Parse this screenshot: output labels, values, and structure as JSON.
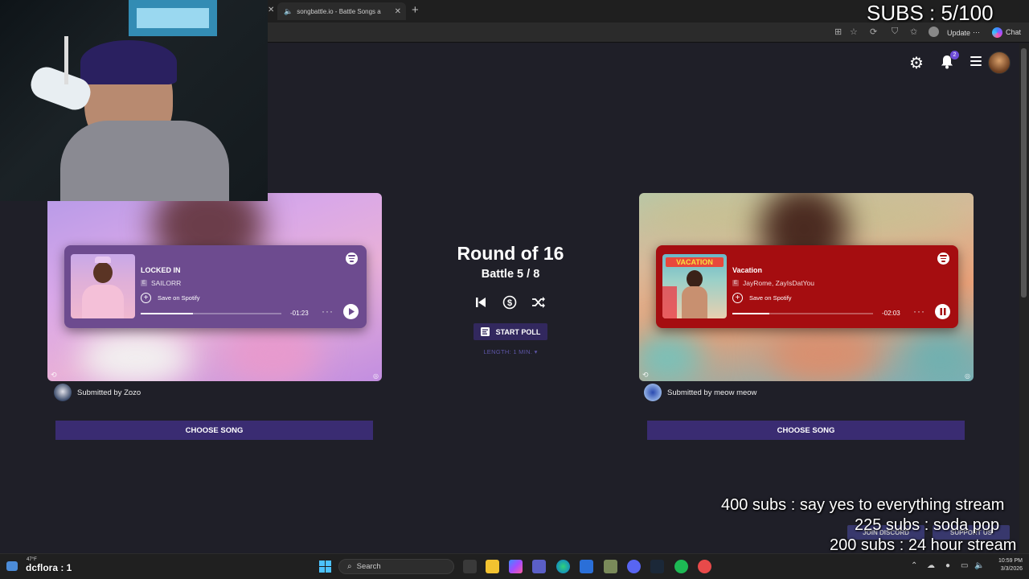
{
  "browser": {
    "tab_title": "songbattle.io - Battle Songs a",
    "update_label": "Update",
    "chat_label": "Chat"
  },
  "header": {
    "notification_count": "2"
  },
  "center": {
    "round_title": "Round of 16",
    "battle_count": "Battle 5 / 8",
    "start_poll_label": "START POLL",
    "length_label": "LENGTH: 1 MIN. ▾"
  },
  "left_song": {
    "title": "LOCKED IN",
    "artist": "SAILORR",
    "explicit": "E",
    "save_label": "Save on Spotify",
    "time_remaining": "-01:23",
    "progress": 0.37,
    "playing": false,
    "submitted_by": "Submitted by Zozo",
    "choose_label": "CHOOSE SONG",
    "card_color": "#6d4b8f"
  },
  "right_song": {
    "title": "Vacation",
    "artist": "JayRome, ZayIsDatYou",
    "explicit": "E",
    "save_label": "Save on Spotify",
    "time_remaining": "-02:03",
    "progress": 0.26,
    "playing": true,
    "submitted_by": "Submitted by meow meow",
    "choose_label": "CHOOSE SONG",
    "card_color": "#a50d10"
  },
  "overlay": {
    "subs_goal": "SUBS : 5/100",
    "goals": [
      "400 subs :  say yes to everything stream",
      "225 subs : soda pop",
      "200 subs : 24 hour stream"
    ],
    "join_discord": "JOIN DISCORD",
    "support_us": "SUPPORT US",
    "chat_counter": "dcflora : 1"
  },
  "taskbar": {
    "weather": "47°F",
    "search_label": "Search",
    "time": "10:59 PM",
    "date": "3/3/2026"
  },
  "colors": {
    "accent": "#3a2c72",
    "spotify_green": "#1db954",
    "background": "#1f1f28"
  }
}
